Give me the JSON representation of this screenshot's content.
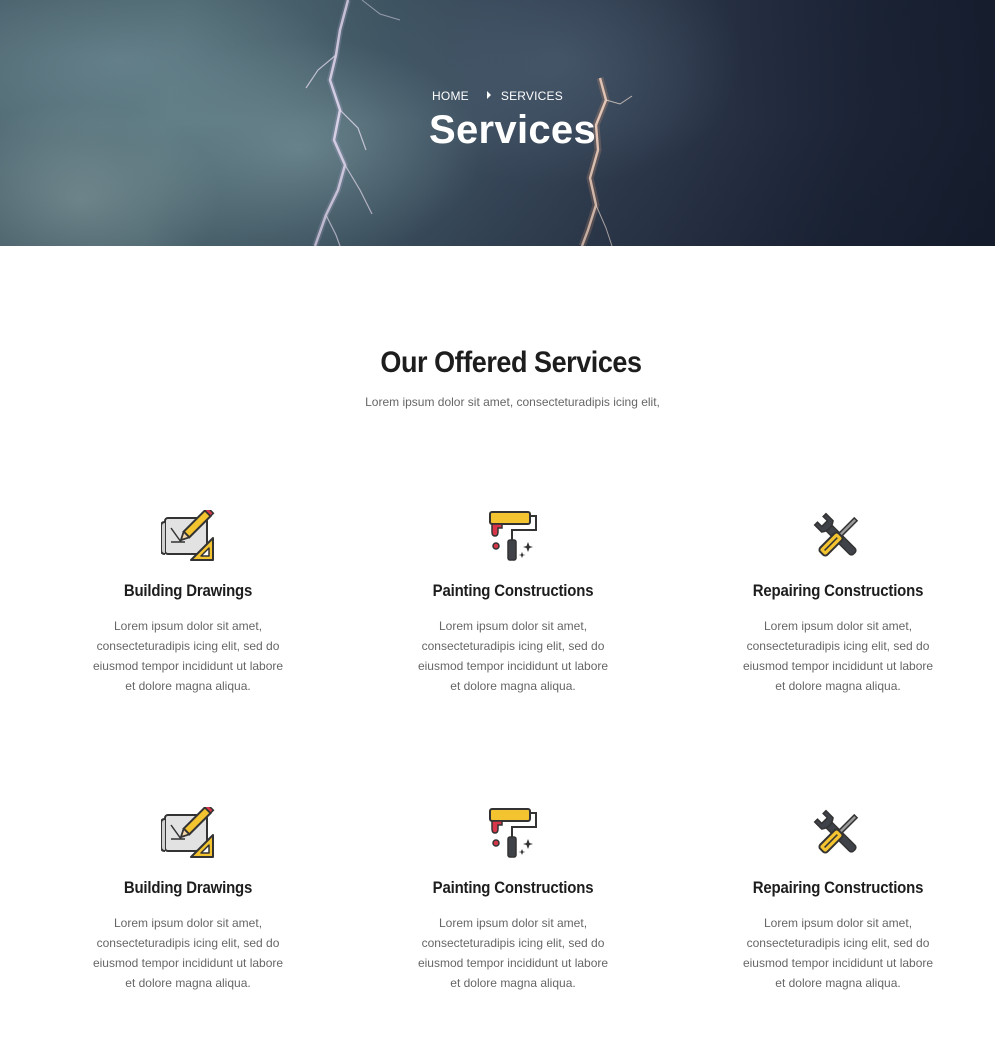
{
  "hero": {
    "breadcrumb": {
      "home": "HOME",
      "current": "SERVICES"
    },
    "title": "Services"
  },
  "section": {
    "title": "Our Offered Services",
    "subtitle": "Lorem ipsum dolor sit amet, consecteturadipis icing elit,"
  },
  "services": [
    {
      "title": "Building Drawings",
      "icon": "blueprint-ruler-icon",
      "desc": "Lorem ipsum dolor sit amet, consecteturadipis icing elit, sed do eiusmod tempor incididunt ut labore et dolore magna aliqua."
    },
    {
      "title": "Painting Constructions",
      "icon": "paint-roller-icon",
      "desc": "Lorem ipsum dolor sit amet, consecteturadipis icing elit, sed do eiusmod tempor incididunt ut labore et dolore magna aliqua."
    },
    {
      "title": "Repairing Constructions",
      "icon": "wrench-screwdriver-icon",
      "desc": "Lorem ipsum dolor sit amet, consecteturadipis icing elit, sed do eiusmod tempor incididunt ut labore et dolore magna aliqua."
    },
    {
      "title": "Building Drawings",
      "icon": "blueprint-ruler-icon",
      "desc": "Lorem ipsum dolor sit amet, consecteturadipis icing elit, sed do eiusmod tempor incididunt ut labore et dolore magna aliqua."
    },
    {
      "title": "Painting Constructions",
      "icon": "paint-roller-icon",
      "desc": "Lorem ipsum dolor sit amet, consecteturadipis icing elit, sed do eiusmod tempor incididunt ut labore et dolore magna aliqua."
    },
    {
      "title": "Repairing Constructions",
      "icon": "wrench-screwdriver-icon",
      "desc": "Lorem ipsum dolor sit amet, consecteturadipis icing elit, sed do eiusmod tempor incididunt ut labore et dolore magna aliqua."
    }
  ],
  "colors": {
    "icon_yellow": "#f4c430",
    "icon_gray": "#e2e2e2",
    "icon_dark": "#3f4249",
    "icon_red": "#d8364a",
    "heading": "#1d1d1d",
    "body_text": "#666666"
  }
}
